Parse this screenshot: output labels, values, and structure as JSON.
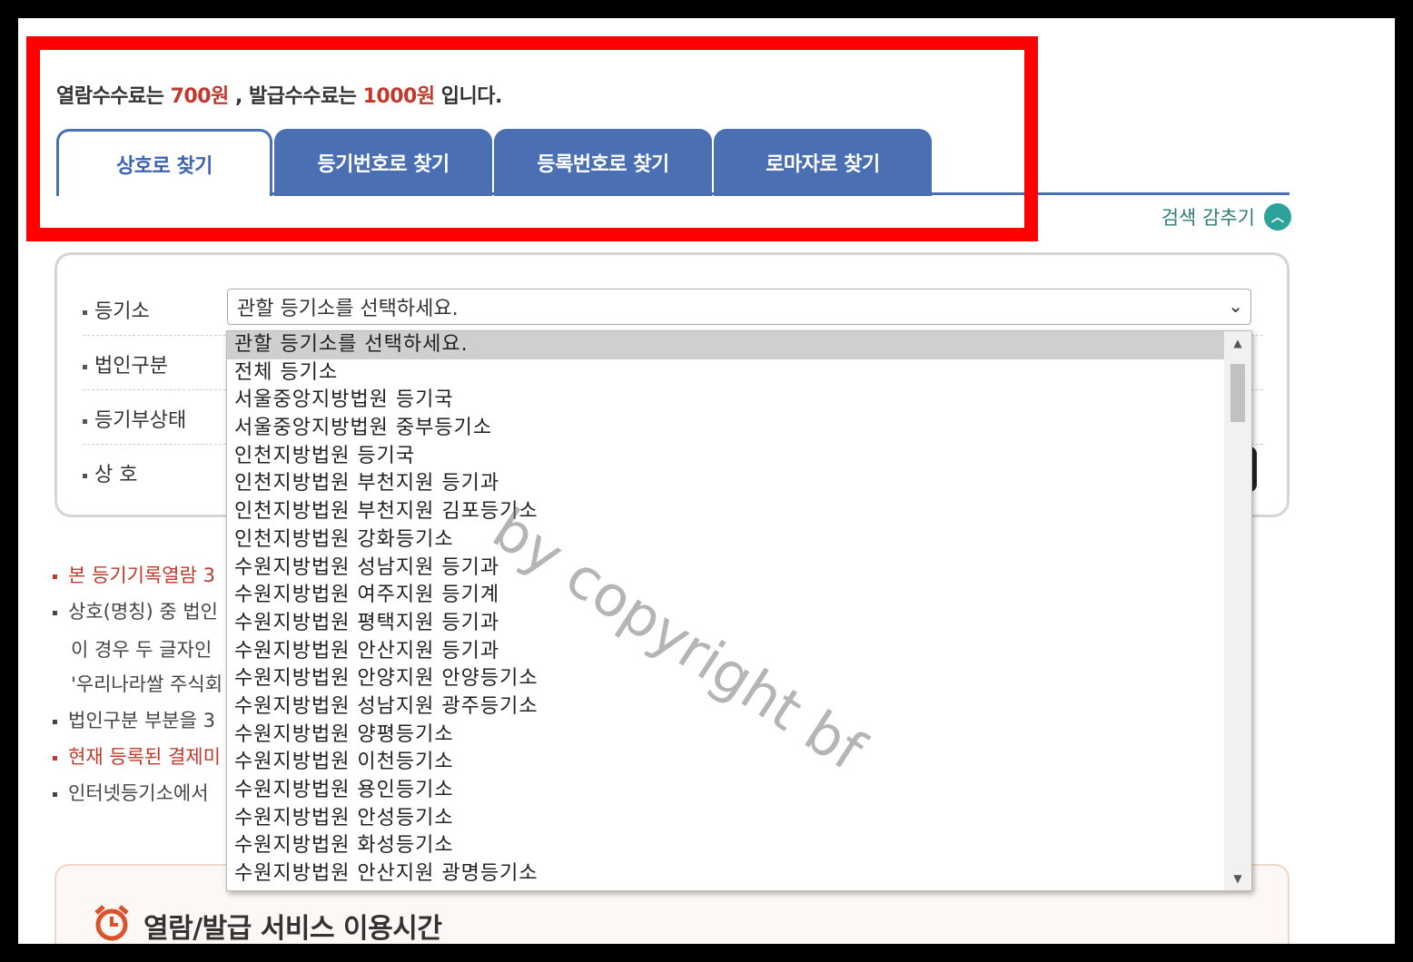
{
  "fee_notice": {
    "prefix": "열람수수료는",
    "view_fee": "700원",
    "middle": ", 발급수수료는",
    "issue_fee": "1000원",
    "suffix": "입니다."
  },
  "tabs": [
    {
      "label": "상호로 찾기",
      "active": true
    },
    {
      "label": "등기번호로 찾기",
      "active": false
    },
    {
      "label": "등록번호로 찾기",
      "active": false
    },
    {
      "label": "로마자로 찾기",
      "active": false
    }
  ],
  "hide_search": {
    "label": "검색 감추기",
    "icon": "chevron-up-icon"
  },
  "form": {
    "registry_label": "등기소",
    "corp_type_label": "법인구분",
    "status_label": "등기부상태",
    "name_label": "상 호",
    "registry_selected": "관할 등기소를 선택하세요."
  },
  "dropdown_options": [
    "관할 등기소를 선택하세요.",
    "전체 등기소",
    "서울중앙지방법원 등기국",
    "서울중앙지방법원 중부등기소",
    "인천지방법원 등기국",
    "인천지방법원 부천지원 등기과",
    "인천지방법원 부천지원 김포등기소",
    "인천지방법원 강화등기소",
    "수원지방법원 성남지원 등기과",
    "수원지방법원 여주지원 등기계",
    "수원지방법원 평택지원 등기과",
    "수원지방법원 안산지원 등기과",
    "수원지방법원 안양지원 안양등기소",
    "수원지방법원 성남지원 광주등기소",
    "수원지방법원 양평등기소",
    "수원지방법원 이천등기소",
    "수원지방법원 용인등기소",
    "수원지방법원 안성등기소",
    "수원지방법원 화성등기소",
    "수원지방법원 안산지원 광명등기소"
  ],
  "notes": [
    {
      "text": "본 등기기록열람",
      "tail": "3",
      "red": true
    },
    {
      "text": "상호(명칭) 중 법인",
      "red": false
    },
    {
      "text": "이 경우 두 글자인",
      "red": false,
      "plain": true
    },
    {
      "text": "'우리나라쌀 주식회",
      "red": false,
      "plain": true
    },
    {
      "text": "법인구분 부분을 3",
      "red": false
    },
    {
      "text": "현재 등록된 결제미",
      "red": true
    },
    {
      "text": "인터넷등기소에서",
      "red": false
    }
  ],
  "watermark": "by copyright bf",
  "service": {
    "title": "열람/발급 서비스 이용시간",
    "icon": "alarm-clock-icon"
  },
  "colors": {
    "accent": "#4b6fb3",
    "fee": "#c0392b",
    "highlight": "#ff0000",
    "teal": "#2ba39a"
  }
}
